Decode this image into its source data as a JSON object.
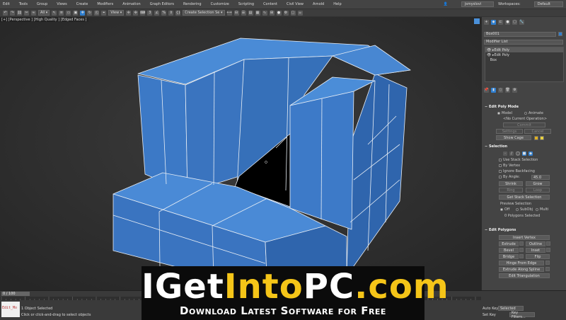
{
  "menu": [
    "Edit",
    "Tools",
    "Group",
    "Views",
    "Create",
    "Modifiers",
    "Animation",
    "Graph Editors",
    "Rendering",
    "Customize",
    "Scripting",
    "Content",
    "Civil View",
    "Arnold",
    "Help"
  ],
  "user": "jsmyslovi",
  "workspaces_label": "Workspaces:",
  "workspace_value": "Default",
  "toolbar": {
    "filter": "All",
    "view": "View",
    "selection_set": "Create Selection Se"
  },
  "viewport": {
    "label": "[+] [Perspective ] [High Quality ] [Edged Faces ]"
  },
  "panel": {
    "object_name": "Box001",
    "modifier_list": "Modifier List",
    "stack": [
      "Edit Poly",
      "Edit Poly",
      "Box"
    ],
    "edit_poly_mode": {
      "title": "Edit Poly Mode",
      "model": "Model",
      "animate": "Animate",
      "no_op": "<No Current Operation>",
      "commit": "Commit",
      "settings": "Settings",
      "cancel": "Cancel",
      "show_cage": "Show Cage"
    },
    "selection": {
      "title": "Selection",
      "use_stack": "Use Stack Selection",
      "by_vertex": "By Vertex",
      "ignore_backfacing": "Ignore Backfacing",
      "by_angle": "By Angle:",
      "angle": "45.0",
      "shrink": "Shrink",
      "grow": "Grow",
      "ring": "Ring",
      "loop": "Loop",
      "get_stack": "Get Stack Selection",
      "preview": "Preview Selection",
      "off": "Off",
      "subobj": "SubObj",
      "multi": "Multi",
      "count": "0 Polygons Selected"
    },
    "edit_polygons": {
      "title": "Edit Polygons",
      "insert_vertex": "Insert Vertex",
      "extrude": "Extrude",
      "outline": "Outline",
      "bevel": "Bevel",
      "inset": "Inset",
      "bridge": "Bridge",
      "flip": "Flip",
      "hinge": "Hinge From Edge",
      "extrude_spline": "Extrude Along Spline",
      "edit_tri": "Edit Triangulation"
    }
  },
  "timeline": {
    "slider": "0 / 100",
    "ticks": [
      "0",
      "5",
      "10",
      "15",
      "20",
      "25",
      "30",
      "35",
      "40",
      "45",
      "50",
      "55",
      "60",
      "65",
      "70",
      "75",
      "80",
      "85",
      "90",
      "95",
      "100"
    ]
  },
  "status": {
    "maxscript": "Edit_Mo",
    "line1": "1 Object Selected",
    "line2": "Click or click-and-drag to select objects",
    "autokey": "Auto Key",
    "setkey": "Set Key",
    "selected": "Selected",
    "key_filters": "Key Filters..."
  },
  "banner": {
    "part1": "IGet",
    "part2": "Into",
    "part3": "PC",
    "part4": ".com",
    "subtitle": "Download Latest Software for Free"
  },
  "colors": {
    "mesh_blue": "#3d7cc9",
    "mesh_dark": "#2d5f9e",
    "accent": "#2f7fd0",
    "banner_yellow": "#f5c518"
  }
}
